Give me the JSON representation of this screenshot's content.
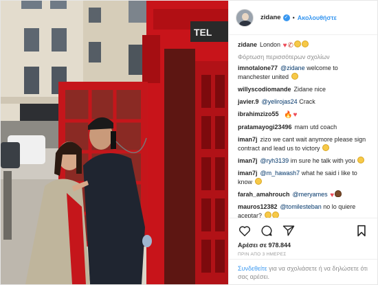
{
  "post": {
    "username": "zidane",
    "follow_label": "Ακολουθήστε",
    "caption_user": "zidane",
    "caption_text": "London",
    "caption_emojis": [
      "red-heart",
      "telephone-receiver",
      "grinning-face",
      "grinning-face"
    ],
    "load_more_label": "Φόρτωση περισσότερων σχολίων",
    "likes_text": "Αρέσει σε 978.844",
    "time_text": "ΠΡΙΝ ΑΠΟ 3 ΗΜΕΡΕΣ"
  },
  "comments": [
    {
      "user": "imnotalone77",
      "mention": "@zidane",
      "text": " welcome to manchester united",
      "emojis": [
        "heart-eyes-face"
      ]
    },
    {
      "user": "willyscodiomande",
      "mention": "",
      "text": "Zidane nice",
      "emojis": []
    },
    {
      "user": "javier.9",
      "mention": "@yelirojas24",
      "text": " Crack",
      "emojis": []
    },
    {
      "user": "ibrahimzizo55",
      "mention": "",
      "text": "",
      "emojis": [
        "fire",
        "red-heart"
      ]
    },
    {
      "user": "pratamayogi23496",
      "mention": "",
      "text": "mam utd coach",
      "emojis": []
    },
    {
      "user": "iman7j",
      "mention": "",
      "text": "zizo we cant wait anymore please sign contract and lead us to victory",
      "emojis": [
        "grinning-face"
      ]
    },
    {
      "user": "iman7j",
      "mention": "@ryh3139",
      "text": " im sure he talk with you",
      "emojis": [
        "grinning-face"
      ]
    },
    {
      "user": "iman7j",
      "mention": "@m_hawash7",
      "text": " what he said i like to know",
      "emojis": [
        "grinning-face"
      ]
    },
    {
      "user": "farah_amahrouch",
      "mention": "@meryames",
      "text": " ",
      "emojis": [
        "red-heart",
        "brown-face"
      ]
    },
    {
      "user": "mauros12382",
      "mention": "@tomilesteban",
      "text": " no lo quiere aceptar?",
      "emojis": [
        "grinning-face",
        "grinning-face"
      ]
    }
  ],
  "login_bar": {
    "link_label": "Συνδεθείτε",
    "text": " για να σχολιάσετε ή να δηλώσετε ότι σας αρέσει."
  },
  "icons": {
    "like": "heart-outline-icon",
    "comment": "comment-bubble-icon",
    "share": "paper-plane-icon",
    "save": "bookmark-icon",
    "verified": "verified-badge-icon"
  },
  "colors": {
    "accent": "#3897f0",
    "mention": "#003569",
    "heart": "#ed4956",
    "phone_box": "#c8141a"
  }
}
